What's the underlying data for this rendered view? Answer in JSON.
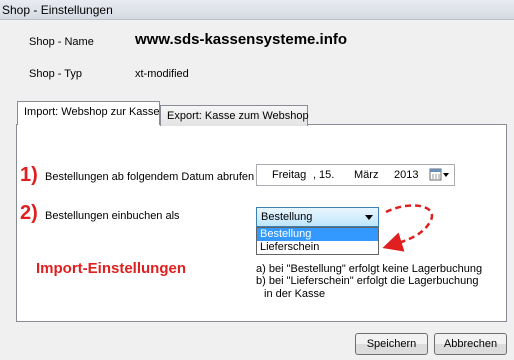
{
  "window": {
    "title": "Shop - Einstellungen"
  },
  "header": {
    "shop_name_label": "Shop - Name",
    "shop_name_value": "www.sds-kassensysteme.info",
    "shop_type_label": "Shop - Typ",
    "shop_type_value": "xt-modified"
  },
  "tabs": [
    {
      "label": "Import: Webshop zur Kasse",
      "active": true
    },
    {
      "label": "Export: Kasse zum Webshop",
      "active": false
    }
  ],
  "import": {
    "step1_number": "1)",
    "step1_label": "Bestellungen ab folgendem Datum abrufen",
    "date": {
      "weekday": "Freitag",
      "sep": ",",
      "day": "15.",
      "month": "März",
      "year": "2013"
    },
    "step2_number": "2)",
    "step2_label": "Bestellungen einbuchen als",
    "combo_value": "Bestellung",
    "options": [
      "Bestellung",
      "Lieferschein"
    ],
    "selected_option": "Bestellung",
    "section_title": "Import-Einstellungen",
    "note_line1": "a) bei \"Bestellung\" erfolgt keine Lagerbuchung",
    "note_line2": "b) bei \"Lieferschein\" erfolgt die Lagerbuchung",
    "note_line3": "in der Kasse"
  },
  "buttons": {
    "save": "Speichern",
    "cancel": "Abbrechen"
  },
  "colors": {
    "annotation": "#e02020",
    "selection": "#3399ff"
  },
  "icons": {
    "calendar": "calendar-icon",
    "dropdown": "chevron-down-icon"
  }
}
